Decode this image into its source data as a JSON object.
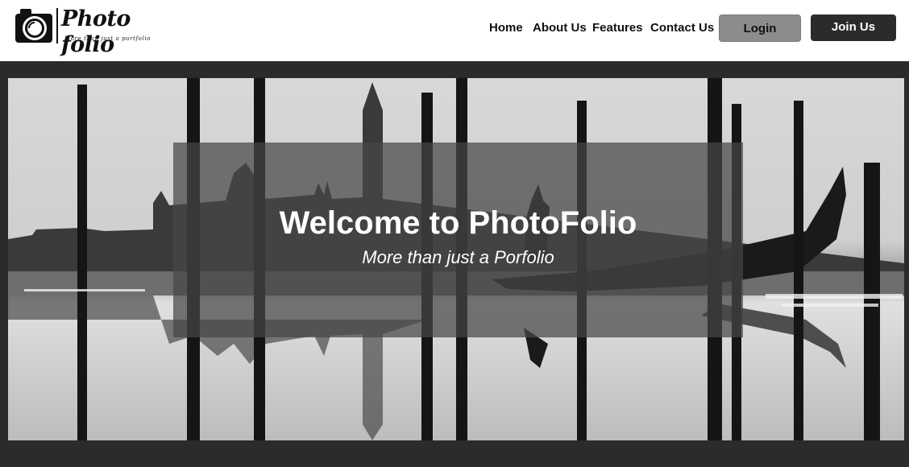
{
  "brand": {
    "name": "Photo folio",
    "tagline": "More than just a portfolio",
    "icon": "camera-icon"
  },
  "nav": {
    "items": [
      {
        "label": "Home"
      },
      {
        "label": "About Us"
      },
      {
        "label": "Features"
      },
      {
        "label": "Contact Us"
      }
    ]
  },
  "auth": {
    "login_label": "Login",
    "join_label": "Join Us"
  },
  "hero": {
    "title": "Welcome to PhotoFolio",
    "subtitle": "More than just a Porfolio",
    "image": "venice-gondola-poles-reflection"
  },
  "colors": {
    "header_bg": "#ffffff",
    "page_bg": "#2b2b2b",
    "login_bg": "#8c8c8c",
    "join_bg": "#2b2b2b",
    "text": "#111111"
  }
}
